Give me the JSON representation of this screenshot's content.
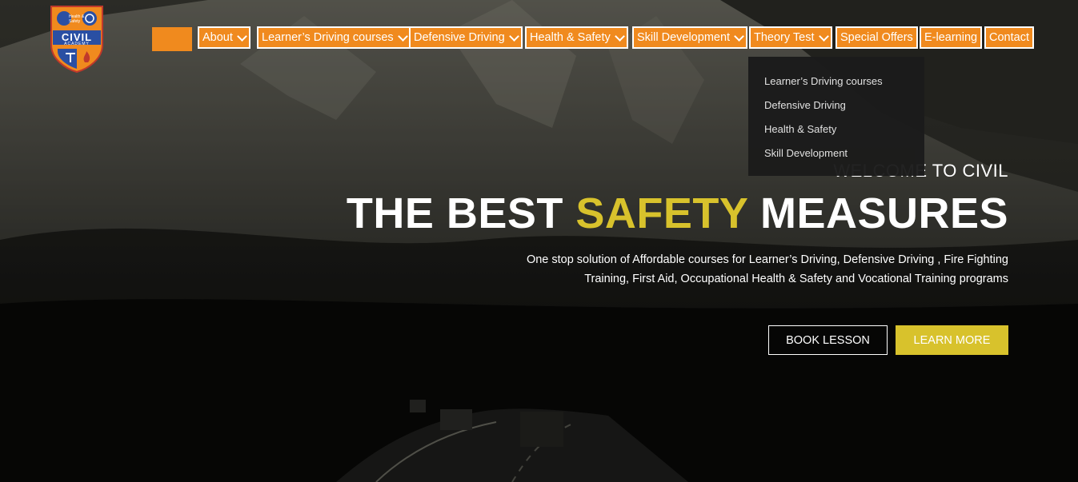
{
  "nav": {
    "home_label": "",
    "items": [
      {
        "label": "About",
        "has_dropdown": true
      },
      {
        "label": "Learner’s Driving courses",
        "has_dropdown": true
      },
      {
        "label": "Defensive Driving",
        "has_dropdown": true
      },
      {
        "label": "Health & Safety",
        "has_dropdown": true
      },
      {
        "label": "Skill Development",
        "has_dropdown": true
      },
      {
        "label": "Theory Test",
        "has_dropdown": true
      },
      {
        "label": "Special Offers",
        "has_dropdown": false
      },
      {
        "label": "E-learning",
        "has_dropdown": false
      },
      {
        "label": "Contact",
        "has_dropdown": false
      }
    ]
  },
  "dropdown": {
    "items": [
      {
        "label": "Learner’s Driving courses"
      },
      {
        "label": "Defensive Driving"
      },
      {
        "label": "Health & Safety"
      },
      {
        "label": "Skill Development"
      }
    ]
  },
  "logo": {
    "top_text": "Health & Safety",
    "name": "CIVIL",
    "sub": "ACADEMY"
  },
  "hero": {
    "welcome": "WELCOME TO CIVIL",
    "headline_part1": "THE BEST ",
    "headline_highlight": "SAFETY",
    "headline_part2": " MEASURES",
    "subtitle_line1": "One stop solution of Affordable courses for Learner’s Driving, Defensive Driving , Fire Fighting",
    "subtitle_line2": "Training, First Aid, Occupational Health & Safety and Vocational Training programs",
    "book_button": "BOOK LESSON",
    "learn_button": "LEARN MORE"
  },
  "colors": {
    "nav_orange": "#f08a1e",
    "accent_yellow": "#d8c22c",
    "dropdown_bg": "#1b1b1b"
  }
}
